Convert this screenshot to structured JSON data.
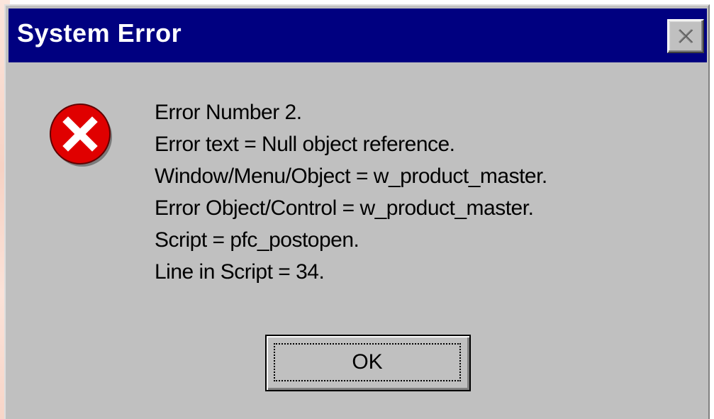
{
  "window": {
    "title": "System Error",
    "close_icon": "close-x-icon",
    "colors": {
      "titlebar": "#000080",
      "body": "#c0c0c0",
      "icon_red": "#e00000"
    }
  },
  "icon": {
    "name": "error-icon"
  },
  "message": {
    "lines": [
      "Error Number 2.",
      "Error text = Null object reference.",
      "Window/Menu/Object = w_product_master.",
      "Error Object/Control = w_product_master.",
      "Script = pfc_postopen.",
      "Line in Script = 34."
    ]
  },
  "buttons": {
    "ok_label": "OK"
  }
}
